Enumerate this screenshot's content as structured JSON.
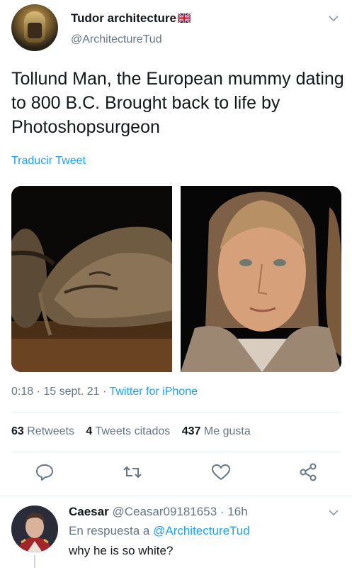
{
  "tweet": {
    "author_name": "Tudor architecture",
    "author_handle": "@ArchitectureTud",
    "text": "Tollund Man, the European mummy dating to 800 B.C. Brought back to life by Photoshopsurgeon",
    "translate_label": "Traducir Tweet",
    "time": "0:18",
    "date": "15 sept. 21",
    "source": "Twitter for iPhone",
    "separator": "·",
    "stats": {
      "retweets_count": "63",
      "retweets_label": "Retweets",
      "quotes_count": "4",
      "quotes_label": "Tweets citados",
      "likes_count": "437",
      "likes_label": "Me gusta"
    },
    "media": {
      "left_image": "mummy-photo",
      "right_image": "reconstruction-photo"
    }
  },
  "reply": {
    "author_name": "Caesar",
    "author_handle": "@Ceasar09181653",
    "separator": "·",
    "age": "16h",
    "replying_prefix": "En respuesta a",
    "replying_to": "@ArchitectureTud",
    "text": "why he is so white?"
  },
  "icons": {
    "reply": "comment-icon",
    "retweet": "retweet-icon",
    "like": "heart-icon",
    "share": "share-icon",
    "menu": "chevron-down-icon"
  },
  "colors": {
    "link": "#1da1f2",
    "secondary_text": "#657786",
    "primary_text": "#14171a",
    "divider": "#e6ecf0"
  }
}
